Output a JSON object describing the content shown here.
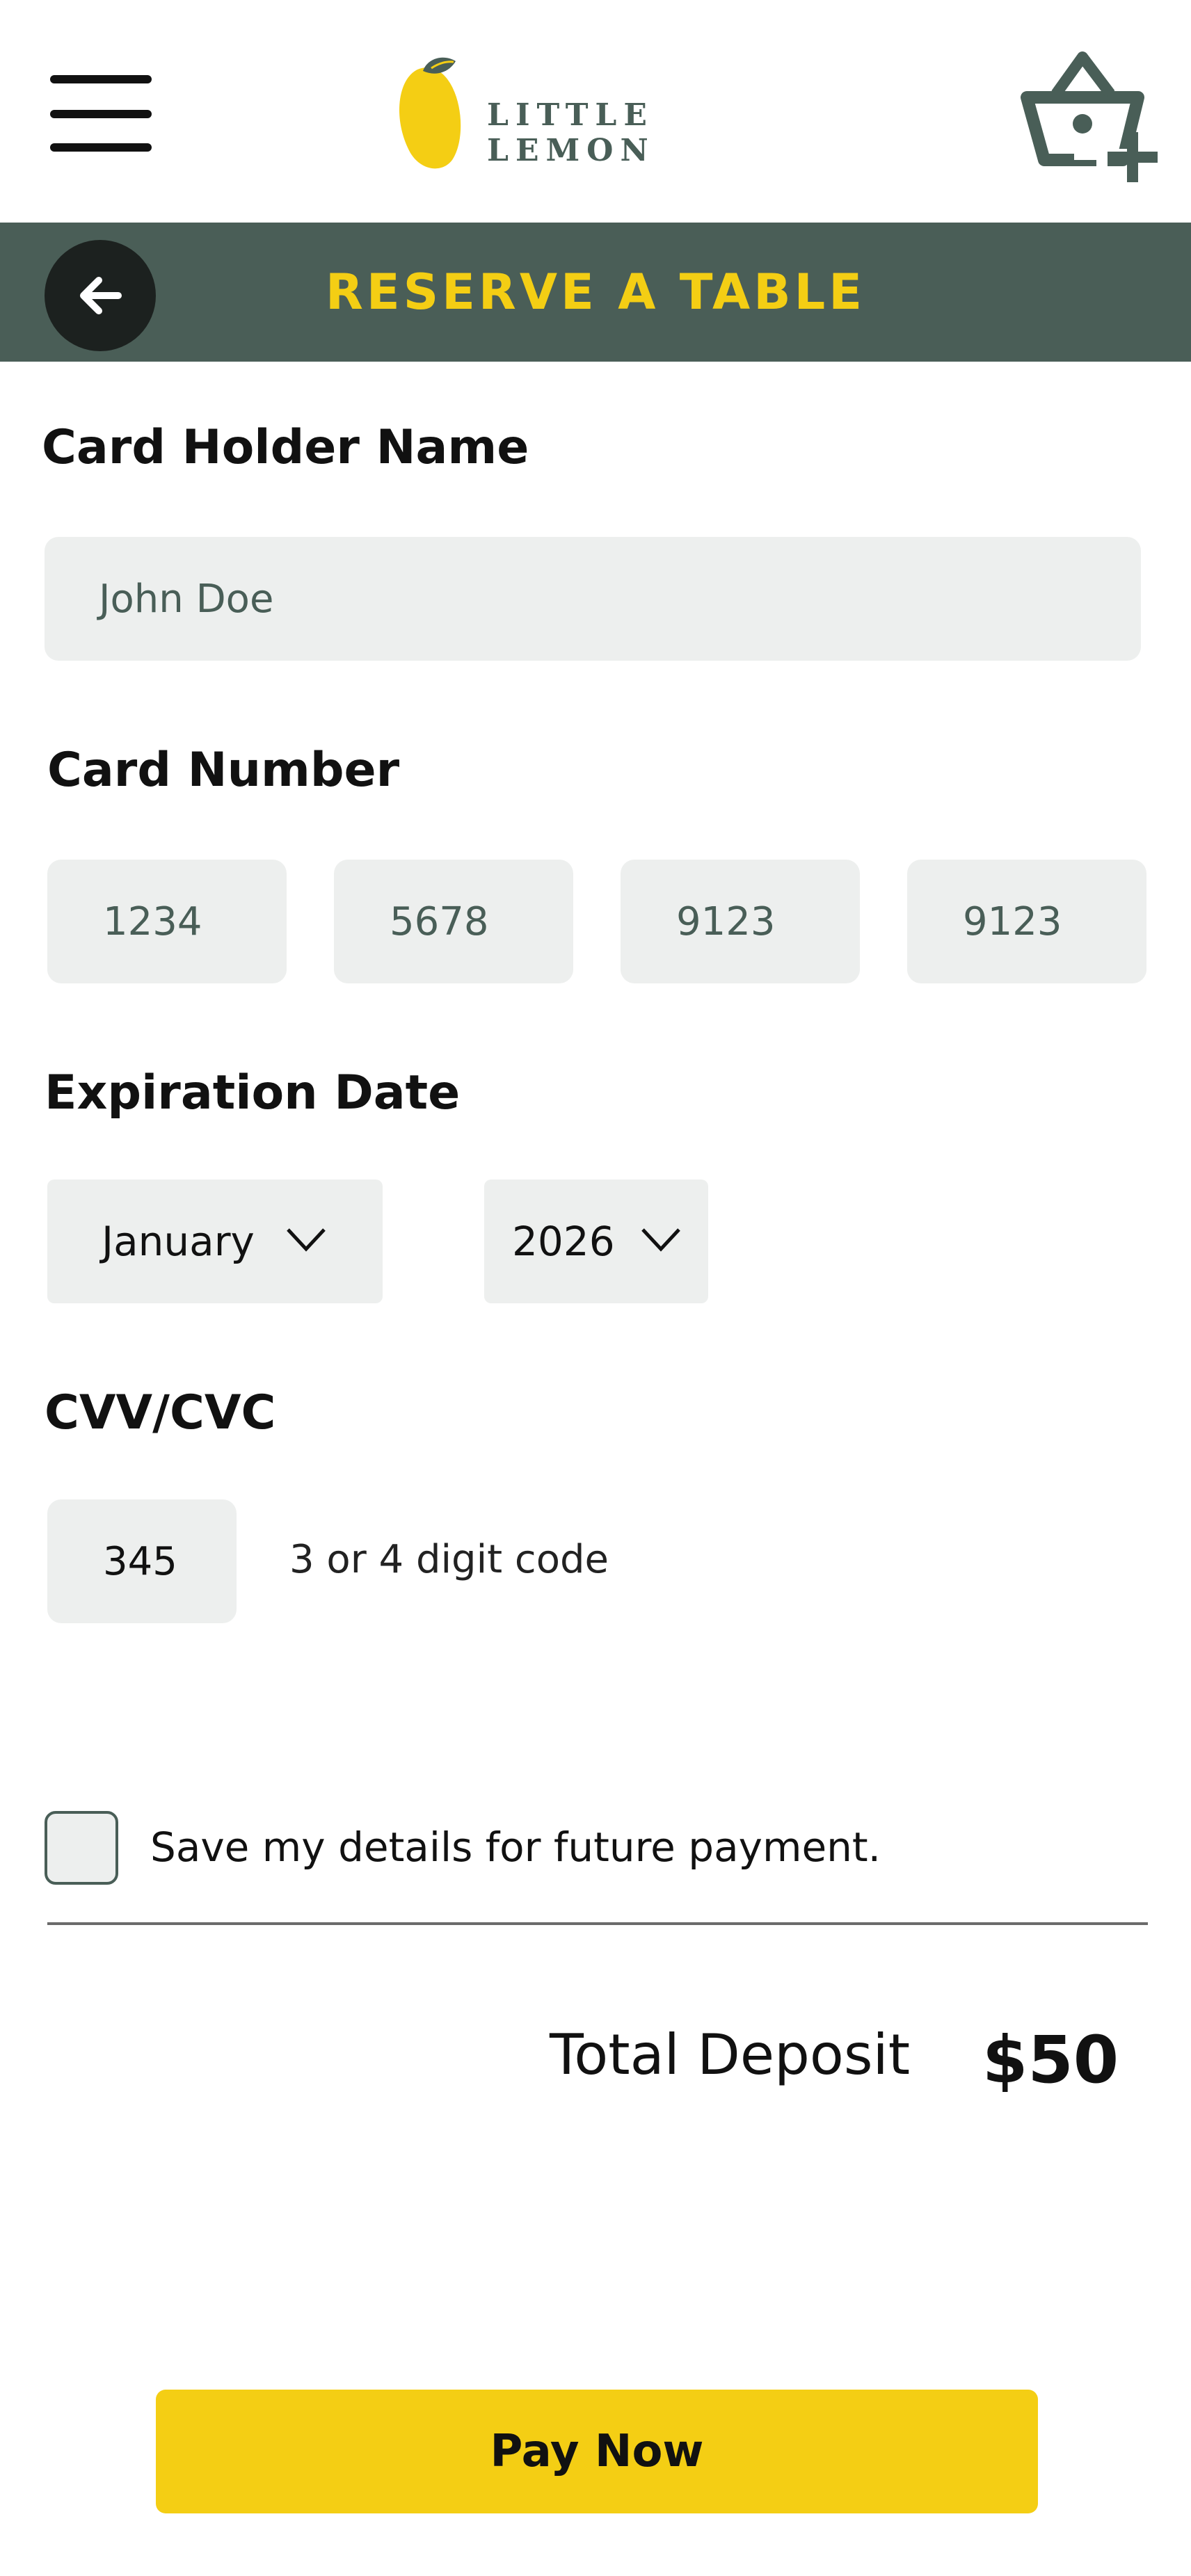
{
  "header": {
    "logo_text": "LITTLE LEMON",
    "menu_icon": "hamburger-menu-icon",
    "cart_icon": "basket-add-icon"
  },
  "titlebar": {
    "title": "RESERVE A TABLE",
    "back_icon": "arrow-left-icon"
  },
  "form": {
    "card_holder": {
      "label": "Card Holder Name",
      "value": "John Doe"
    },
    "card_number": {
      "label": "Card Number",
      "groups": [
        "1234",
        "5678",
        "9123",
        "9123"
      ]
    },
    "expiration": {
      "label": "Expiration Date",
      "month": "January",
      "year": "2026"
    },
    "cvv": {
      "label": "CVV/CVC",
      "value": "345",
      "hint": "3 or 4 digit code"
    },
    "save_details": {
      "label": "Save my details for future payment.",
      "checked": false
    }
  },
  "summary": {
    "label": "Total Deposit",
    "amount": "$50"
  },
  "actions": {
    "pay_label": "Pay Now"
  },
  "colors": {
    "brand_green": "#495e57",
    "brand_yellow": "#f4ce14",
    "field_bg": "#edefee",
    "dark": "#1c211f"
  }
}
